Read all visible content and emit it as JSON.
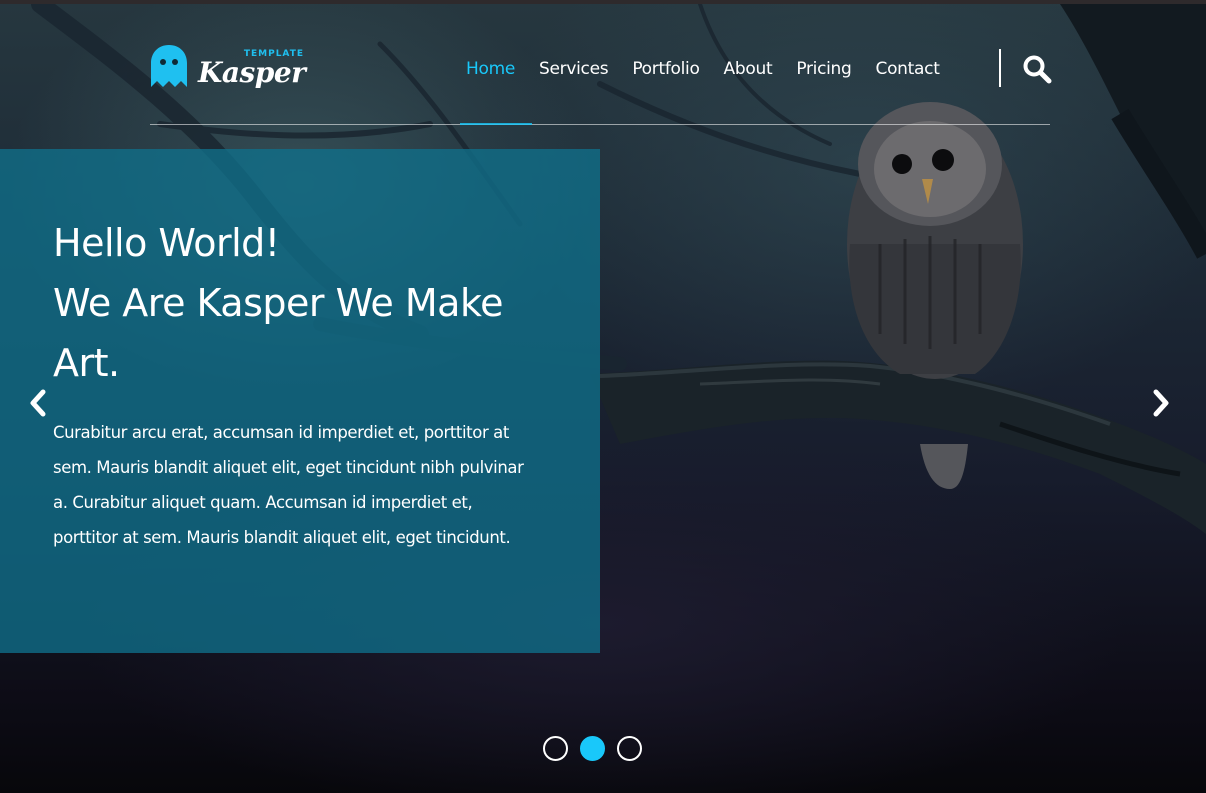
{
  "header": {
    "logo": {
      "tag": "TEMPLATE",
      "word": "Kasper",
      "icon": "ghost-icon",
      "icon_color": "#1fc0f0"
    },
    "nav": {
      "items": [
        {
          "label": "Home",
          "active": true
        },
        {
          "label": "Services",
          "active": false
        },
        {
          "label": "Portfolio",
          "active": false
        },
        {
          "label": "About",
          "active": false
        },
        {
          "label": "Pricing",
          "active": false
        },
        {
          "label": "Contact",
          "active": false
        }
      ],
      "search_icon": "search-icon"
    }
  },
  "hero": {
    "title_line1": "Hello World!",
    "title_line2": "We Are Kasper We Make",
    "title_line3": "Art.",
    "body": "Curabitur arcu erat, accumsan id imperdiet et, porttitor at sem. Mauris blandit aliquet elit, eget tincidunt nibh pulvinar a. Curabitur aliquet quam. Accumsan id imperdiet et, porttitor at sem. Mauris blandit aliquet elit, eget tincidunt.",
    "prev_icon": "chevron-left-icon",
    "next_icon": "chevron-right-icon",
    "background_image": "owl-on-branch-photo"
  },
  "slider": {
    "slides": 3,
    "active_index": 1
  },
  "colors": {
    "accent": "#19c8fa",
    "panel": "#10708a",
    "text": "#ffffff"
  }
}
